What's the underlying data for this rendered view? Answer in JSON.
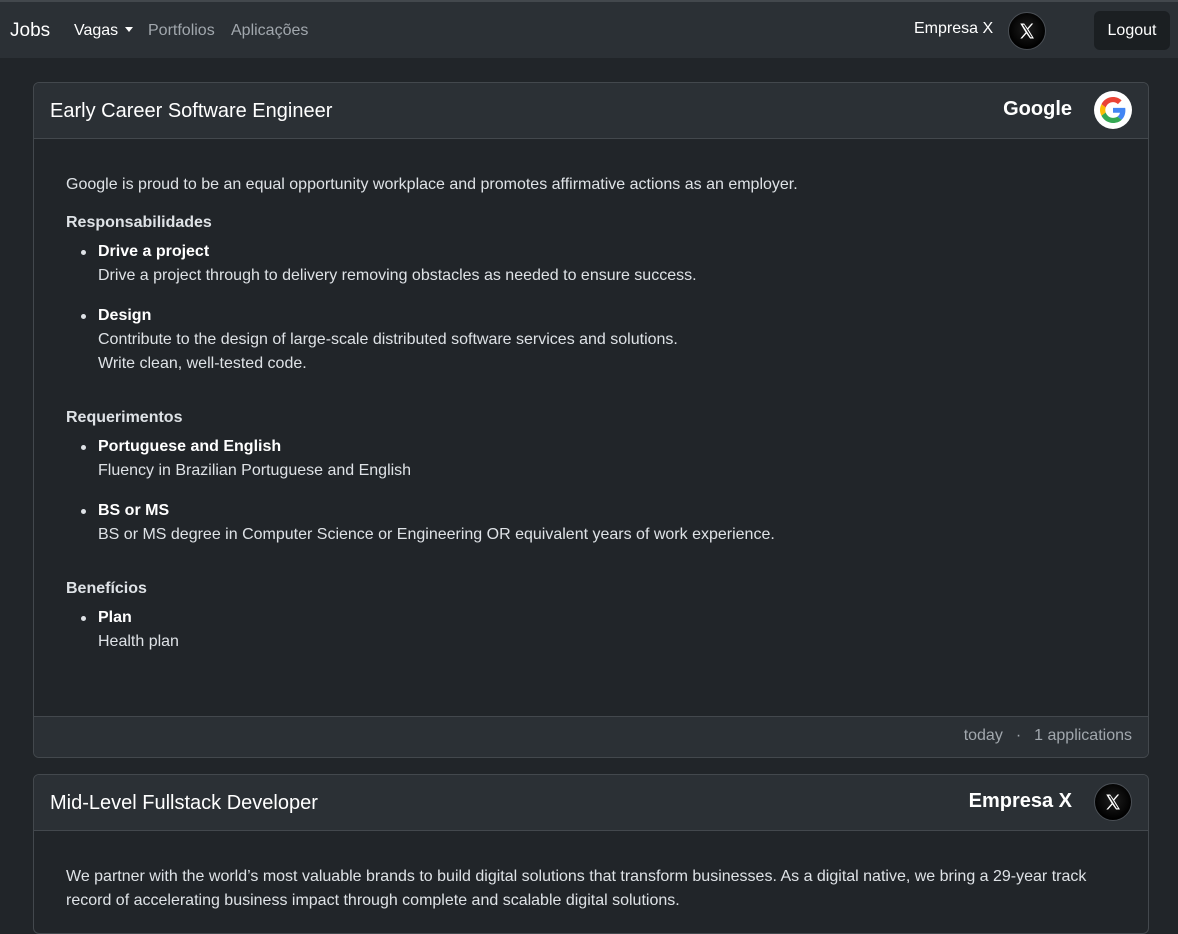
{
  "navbar": {
    "brand": "Jobs",
    "links": {
      "vagas": "Vagas",
      "portfolios": "Portfolios",
      "aplicacoes": "Aplicações"
    },
    "company": "Empresa X",
    "logout": "Logout"
  },
  "jobs": [
    {
      "title": "Early Career Software Engineer",
      "company": "Google",
      "logo_icon": "google-logo-icon",
      "description": "Google is proud to be an equal opportunity workplace and promotes affirmative actions as an employer.",
      "sections": {
        "responsibilities": {
          "title": "Responsabilidades",
          "items": [
            {
              "title": "Drive a project",
              "lines": [
                "Drive a project through to delivery removing obstacles as needed to ensure success."
              ]
            },
            {
              "title": "Design",
              "lines": [
                "Contribute to the design of large-scale distributed software services and solutions.",
                "Write clean, well-tested code."
              ]
            }
          ]
        },
        "requirements": {
          "title": "Requerimentos",
          "items": [
            {
              "title": "Portuguese and English",
              "lines": [
                "Fluency in Brazilian Portuguese and English"
              ]
            },
            {
              "title": "BS or MS",
              "lines": [
                "BS or MS degree in Computer Science or Engineering OR equivalent years of work experience."
              ]
            }
          ]
        },
        "benefits": {
          "title": "Benefícios",
          "items": [
            {
              "title": "Plan",
              "lines": [
                "Health plan"
              ]
            }
          ]
        }
      },
      "footer": {
        "posted": "today",
        "separator": "·",
        "applications": "1 applications"
      }
    },
    {
      "title": "Mid-Level Fullstack Developer",
      "company": "Empresa X",
      "logo_icon": "x-logo-icon",
      "description": "We partner with the world’s most valuable brands to build digital solutions that transform businesses. As a digital native, we bring a 29-year track record of accelerating business impact through complete and scalable digital solutions."
    }
  ],
  "colors": {
    "background": "#212529",
    "navbar": "#2b3035",
    "card_header": "#2b3035",
    "border": "#43484d",
    "muted_text": "#a1a7ad"
  }
}
